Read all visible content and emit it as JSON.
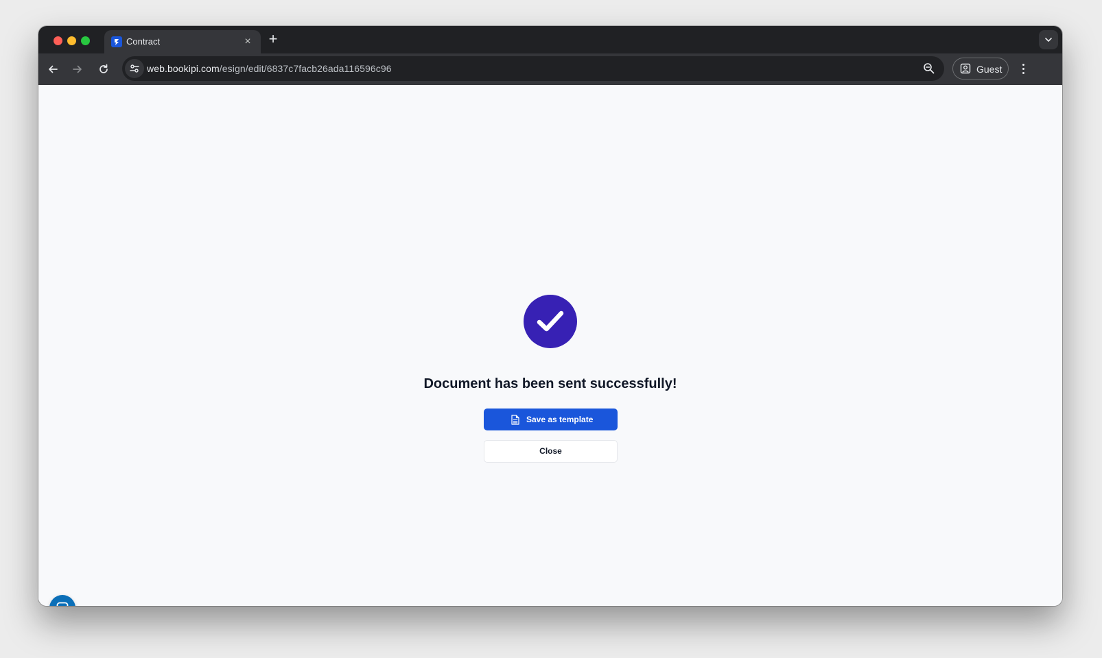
{
  "browser": {
    "tab": {
      "title": "Contract",
      "favicon": "bookipi-favicon",
      "close_icon": "×"
    },
    "new_tab_icon": "+",
    "omnibox": {
      "url_host": "web.bookipi.com",
      "url_path": "/esign/edit/6837c7facb26ada116596c96"
    },
    "profile": {
      "label": "Guest"
    }
  },
  "page": {
    "heading": "Document has been sent successfully!",
    "primary_button": "Save as template",
    "secondary_button": "Close",
    "colors": {
      "success_circle": "#3721b4",
      "primary_button": "#1a56db",
      "chat_launcher": "#0b6fb8"
    }
  }
}
